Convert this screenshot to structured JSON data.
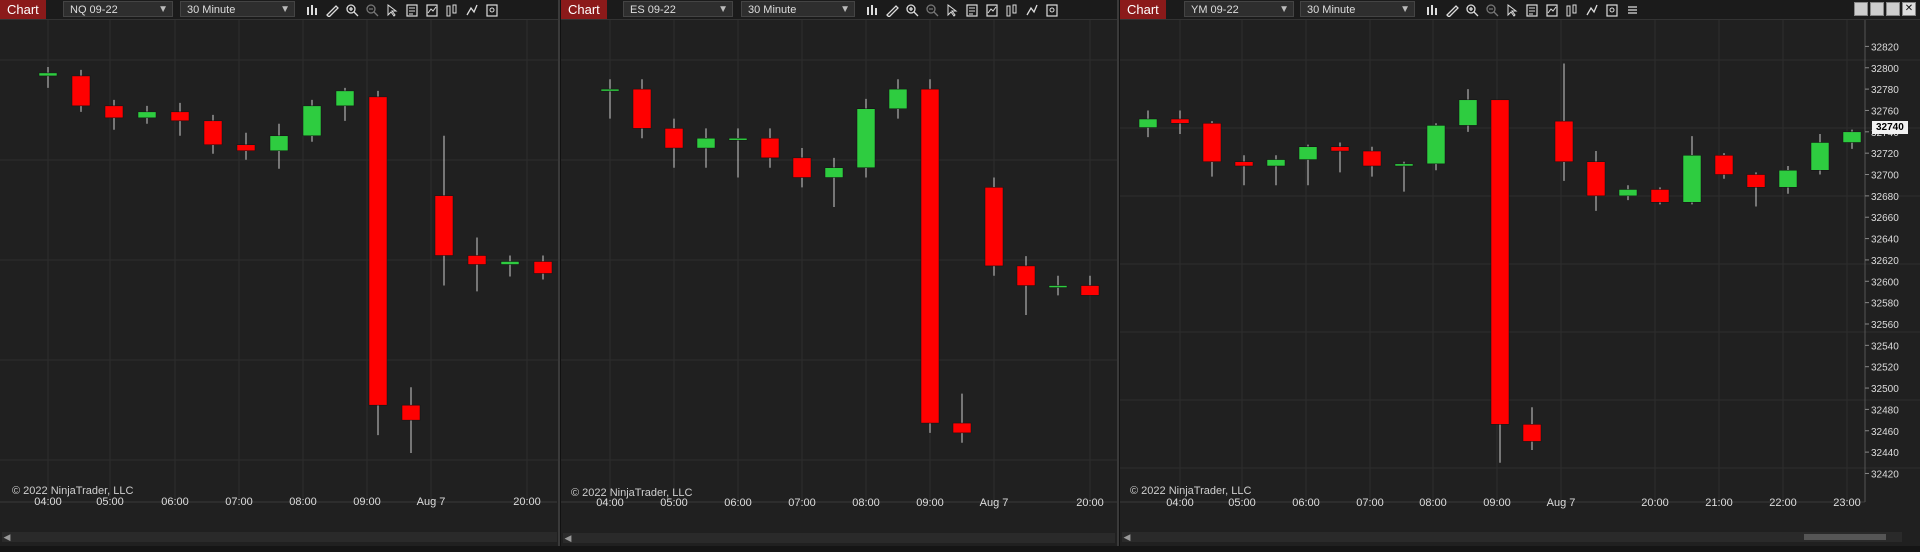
{
  "panels": [
    {
      "tab": "Chart",
      "instrument": "NQ 09-22",
      "interval": "30 Minute",
      "copyright": "© 2022 NinjaTrader, LLC",
      "x_labels": [
        "04:00",
        "05:00",
        "06:00",
        "07:00",
        "08:00",
        "09:00",
        "Aug 7",
        "20:00"
      ]
    },
    {
      "tab": "Chart",
      "instrument": "ES 09-22",
      "interval": "30 Minute",
      "copyright": "© 2022 NinjaTrader, LLC",
      "x_labels": [
        "04:00",
        "05:00",
        "06:00",
        "07:00",
        "08:00",
        "09:00",
        "Aug 7",
        "20:00"
      ]
    },
    {
      "tab": "Chart",
      "instrument": "YM 09-22",
      "interval": "30 Minute",
      "copyright": "© 2022 NinjaTrader, LLC",
      "x_labels": [
        "04:00",
        "05:00",
        "06:00",
        "07:00",
        "08:00",
        "09:00",
        "Aug 7",
        "20:00",
        "21:00",
        "22:00",
        "23:00"
      ],
      "y_labels": [
        "32820",
        "32800",
        "32780",
        "32760",
        "32740",
        "32720",
        "32700",
        "32680",
        "32660",
        "32640",
        "32620",
        "32600",
        "32580",
        "32560",
        "32540",
        "32520",
        "32500",
        "32480",
        "32460",
        "32440",
        "32420"
      ],
      "last_price": "32740"
    }
  ],
  "colors": {
    "up": "#2ecc40",
    "down": "#ff0000",
    "tab": "#8b1a1a",
    "grid": "#2e2e2e",
    "background": "#202020"
  },
  "toolbar_icons": [
    "bar-type-icon",
    "draw-icon",
    "zoom-in-icon",
    "zoom-out-icon",
    "pointer-icon",
    "data-box-icon",
    "indicators-icon",
    "strategies-icon",
    "templates-icon",
    "properties-icon"
  ],
  "chart_data": [
    {
      "type": "candlestick",
      "instrument": "NQ 09-22",
      "x": [
        "04:00",
        "04:30",
        "05:00",
        "05:30",
        "06:00",
        "06:30",
        "07:00",
        "07:30",
        "08:00",
        "08:30",
        "09:00",
        "09:30",
        "Aug 7",
        "19:30",
        "20:00",
        "20:30"
      ],
      "candles": [
        [
          13500,
          13503,
          13496,
          13501
        ],
        [
          13500,
          13502,
          13488,
          13490
        ],
        [
          13490,
          13492,
          13482,
          13486
        ],
        [
          13486,
          13490,
          13484,
          13488
        ],
        [
          13488,
          13491,
          13480,
          13485
        ],
        [
          13485,
          13487,
          13474,
          13477
        ],
        [
          13477,
          13481,
          13472,
          13475
        ],
        [
          13475,
          13484,
          13469,
          13480
        ],
        [
          13480,
          13492,
          13478,
          13490
        ],
        [
          13490,
          13496,
          13485,
          13495
        ],
        [
          13493,
          13495,
          13380,
          13390
        ],
        [
          13390,
          13396,
          13374,
          13385
        ],
        [
          13460,
          13480,
          13430,
          13440
        ],
        [
          13440,
          13446,
          13428,
          13437
        ],
        [
          13437,
          13440,
          13433,
          13438
        ],
        [
          13438,
          13440,
          13432,
          13434
        ]
      ]
    },
    {
      "type": "candlestick",
      "instrument": "ES 09-22",
      "x": [
        "04:00",
        "04:30",
        "05:00",
        "05:30",
        "06:00",
        "06:30",
        "07:00",
        "07:30",
        "08:00",
        "08:30",
        "09:00",
        "09:30",
        "Aug 7",
        "19:30",
        "20:00",
        "20:30"
      ],
      "candles": [
        [
          4125,
          4126,
          4122,
          4125
        ],
        [
          4125,
          4126,
          4120,
          4121
        ],
        [
          4121,
          4122,
          4117,
          4119
        ],
        [
          4119,
          4121,
          4117,
          4120
        ],
        [
          4120,
          4121,
          4116,
          4120
        ],
        [
          4120,
          4121,
          4117,
          4118
        ],
        [
          4118,
          4119,
          4115,
          4116
        ],
        [
          4116,
          4118,
          4113,
          4117
        ],
        [
          4117,
          4124,
          4116,
          4123
        ],
        [
          4123,
          4126,
          4122,
          4125
        ],
        [
          4125,
          4126,
          4090,
          4091
        ],
        [
          4091,
          4094,
          4089,
          4090
        ],
        [
          4115,
          4116,
          4106,
          4107
        ],
        [
          4107,
          4108,
          4102,
          4105
        ],
        [
          4105,
          4106,
          4104,
          4105
        ],
        [
          4105,
          4106,
          4104,
          4104
        ]
      ]
    },
    {
      "type": "candlestick",
      "instrument": "YM 09-22",
      "x": [
        "04:00",
        "04:30",
        "05:00",
        "05:30",
        "06:00",
        "06:30",
        "07:00",
        "07:30",
        "08:00",
        "08:30",
        "09:00",
        "09:30",
        "Aug 7",
        "19:30",
        "20:00",
        "20:30",
        "21:00",
        "21:30",
        "22:00",
        "22:30",
        "23:00"
      ],
      "candles": [
        [
          32744,
          32760,
          32735,
          32752
        ],
        [
          32752,
          32760,
          32738,
          32748
        ],
        [
          32748,
          32750,
          32698,
          32712
        ],
        [
          32712,
          32718,
          32690,
          32708
        ],
        [
          32708,
          32718,
          32690,
          32714
        ],
        [
          32714,
          32728,
          32690,
          32726
        ],
        [
          32726,
          32730,
          32702,
          32722
        ],
        [
          32722,
          32726,
          32698,
          32708
        ],
        [
          32708,
          32712,
          32684,
          32710
        ],
        [
          32710,
          32748,
          32704,
          32746
        ],
        [
          32746,
          32780,
          32740,
          32770
        ],
        [
          32770,
          32770,
          32430,
          32466
        ],
        [
          32466,
          32482,
          32442,
          32450
        ],
        [
          32750,
          32804,
          32694,
          32712
        ],
        [
          32712,
          32722,
          32666,
          32680
        ],
        [
          32680,
          32690,
          32676,
          32686
        ],
        [
          32686,
          32688,
          32672,
          32674
        ],
        [
          32674,
          32736,
          32672,
          32718
        ],
        [
          32718,
          32720,
          32696,
          32700
        ],
        [
          32700,
          32702,
          32670,
          32688
        ],
        [
          32688,
          32708,
          32682,
          32704
        ],
        [
          32704,
          32738,
          32700,
          32730
        ],
        [
          32730,
          32742,
          32724,
          32740
        ]
      ]
    }
  ]
}
